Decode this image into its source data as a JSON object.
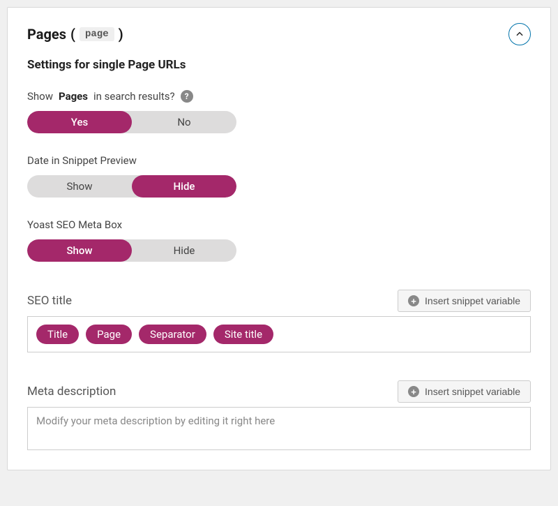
{
  "header": {
    "title_prefix": "Pages",
    "paren_open": "(",
    "slug": "page",
    "paren_close": ")"
  },
  "subheader": "Settings for single Page URLs",
  "showInSearch": {
    "label_prefix": "Show",
    "label_bold": "Pages",
    "label_suffix": "in search results?",
    "option_yes": "Yes",
    "option_no": "No",
    "help_glyph": "?"
  },
  "dateSnippet": {
    "label": "Date in Snippet Preview",
    "option_show": "Show",
    "option_hide": "Hide"
  },
  "metaBox": {
    "label": "Yoast SEO Meta Box",
    "option_show": "Show",
    "option_hide": "Hide"
  },
  "seoTitle": {
    "label": "SEO title",
    "insert_btn": "Insert snippet variable",
    "plus_glyph": "+",
    "variables": [
      "Title",
      "Page",
      "Separator",
      "Site title"
    ]
  },
  "metaDescription": {
    "label": "Meta description",
    "insert_btn": "Insert snippet variable",
    "plus_glyph": "+",
    "placeholder": "Modify your meta description by editing it right here"
  },
  "colors": {
    "accent": "#a4286a",
    "toggle_bg": "#dddcdc"
  }
}
